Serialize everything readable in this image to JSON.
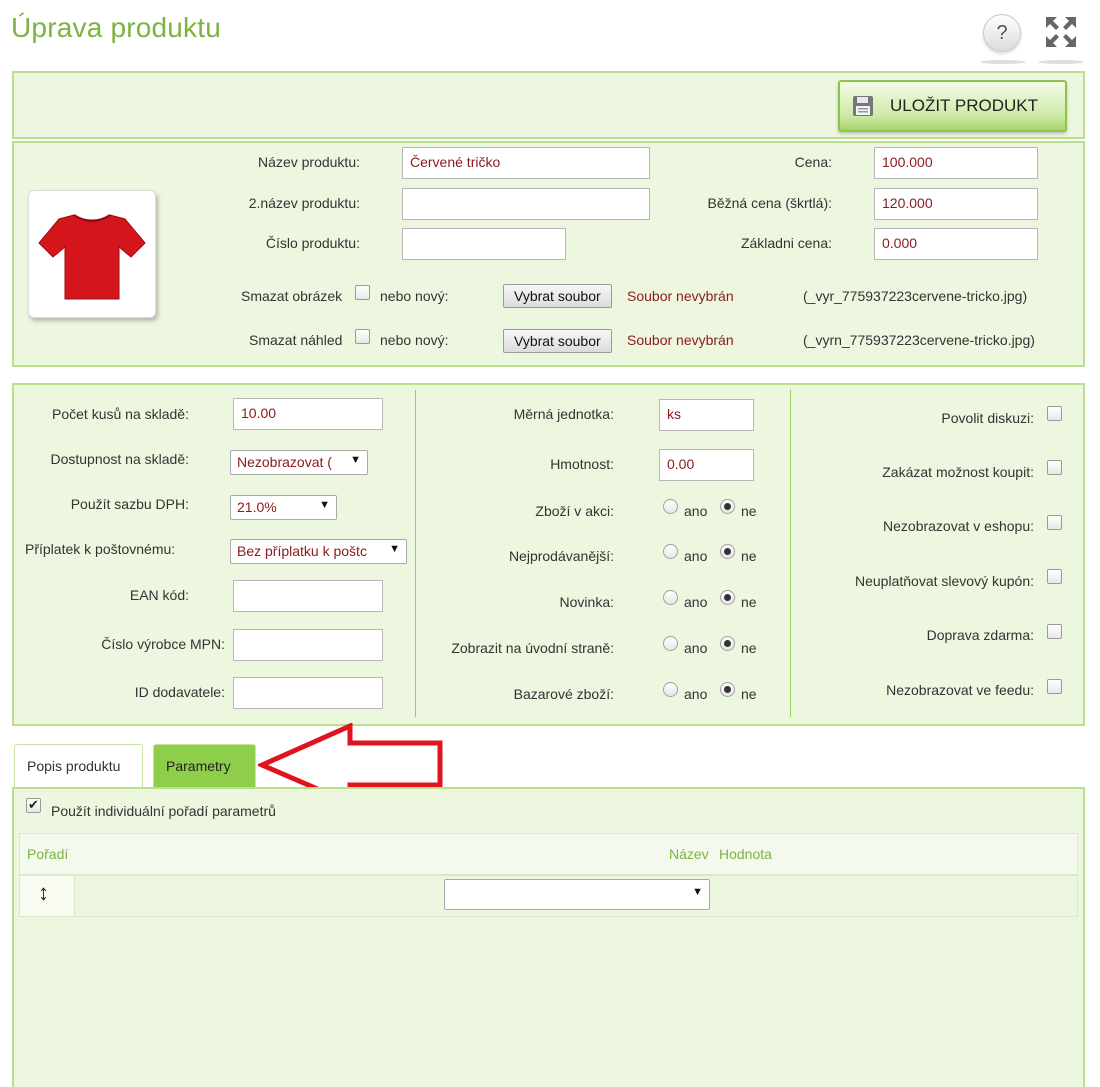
{
  "page": {
    "title": "Úprava produktu"
  },
  "toolbar": {
    "help_symbol": "?",
    "save_label": "ULOŽIT PRODUKT"
  },
  "product": {
    "name_label": "Název produktu:",
    "name_value": "Červené tričko",
    "name2_label": "2.název produktu:",
    "name2_value": "",
    "number_label": "Číslo produktu:",
    "number_value": "",
    "price_label": "Cena:",
    "price_value": "100.000",
    "regular_price_label": "Běžná cena (škrtlá):",
    "regular_price_value": "120.000",
    "base_price_label": "Základni cena:",
    "base_price_value": "0.000",
    "delete_image_label": "Smazat obrázek",
    "delete_preview_label": "Smazat náhled",
    "or_new_label": "nebo nový:",
    "choose_file_label": "Vybrat soubor",
    "no_file_label": "Soubor nevybrán",
    "image_file": "(_vyr_775937223cervene-tricko.jpg)",
    "preview_file": "(_vyrn_775937223cervene-tricko.jpg)",
    "tshirt_color": "#d4151c"
  },
  "stock": {
    "qty_label": "Počet kusů na skladě:",
    "qty_value": "10.00",
    "availability_label": "Dostupnost na skladě:",
    "availability_value": "Nezobrazovat (",
    "vat_label": "Použít sazbu DPH:",
    "vat_value": "21.0%",
    "postage_label": "Příplatek k poštovnému:",
    "postage_value": "Bez příplatku k poštc",
    "ean_label": "EAN kód:",
    "ean_value": "",
    "mpn_label": "Číslo výrobce MPN:",
    "mpn_value": "",
    "supplier_label": "ID dodavatele:",
    "supplier_value": ""
  },
  "attributes": {
    "unit_label": "Měrná jednotka:",
    "unit_value": "ks",
    "weight_label": "Hmotnost:",
    "weight_value": "0.00",
    "yes_label": "ano",
    "no_label": "ne",
    "radios": [
      {
        "label": "Zboží v akci:",
        "selected": "ne"
      },
      {
        "label": "Nejprodávanější:",
        "selected": "ne"
      },
      {
        "label": "Novinka:",
        "selected": "ne"
      },
      {
        "label": "Zobrazit na úvodní straně:",
        "selected": "ne"
      },
      {
        "label": "Bazarové zboží:",
        "selected": "ne"
      }
    ]
  },
  "flags": {
    "items": [
      {
        "label": "Povolit diskuzi:",
        "checked": false
      },
      {
        "label": "Zakázat možnost koupit:",
        "checked": false
      },
      {
        "label": "Nezobrazovat v eshopu:",
        "checked": false
      },
      {
        "label": "Neuplatňovat slevový kupón:",
        "checked": false
      },
      {
        "label": "Doprava zdarma:",
        "checked": false
      },
      {
        "label": "Nezobrazovat ve feedu:",
        "checked": false
      }
    ]
  },
  "tabs": {
    "description_label": "Popis produktu",
    "parameters_label": "Parametry"
  },
  "parameters": {
    "individual_order_label": "Použít individuální pořadí parametrů",
    "individual_order_checked": true,
    "col_order": "Pořadí",
    "col_name": "Název",
    "col_value": "Hodnota",
    "drag_symbol": "↕",
    "select_value": ""
  },
  "colors": {
    "accent": "#7cb342",
    "panel_bg": "#edf7df",
    "panel_border": "#b9e08a",
    "active_tab": "#8fce4a",
    "arrow_annotation": "#e0141e",
    "value_text": "#8b1a1a"
  }
}
